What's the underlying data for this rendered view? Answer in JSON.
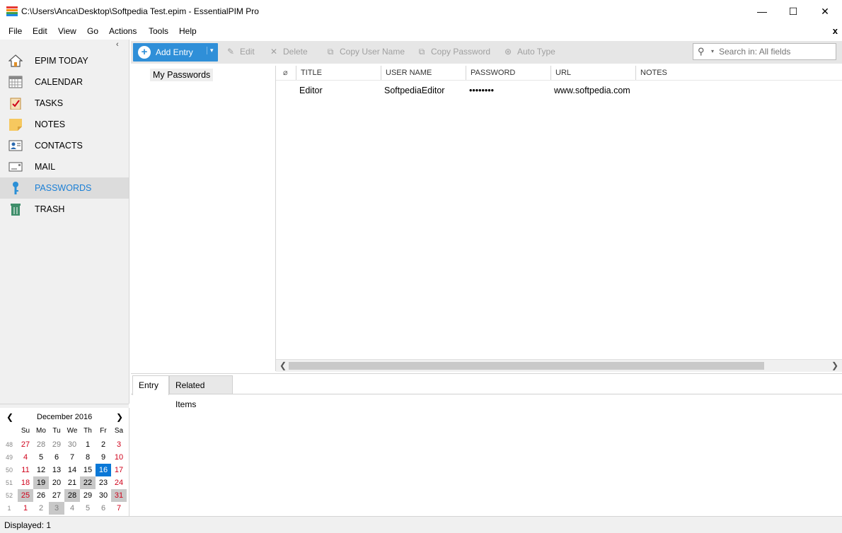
{
  "window": {
    "title": "C:\\Users\\Anca\\Desktop\\Softpedia Test.epim - EssentialPIM Pro",
    "minimize": "—",
    "maximize": "☐",
    "close": "✕"
  },
  "menu": {
    "items": [
      "File",
      "Edit",
      "View",
      "Go",
      "Actions",
      "Tools",
      "Help"
    ],
    "close": "x"
  },
  "sidebar": {
    "collapse": "‹",
    "items": [
      {
        "label": "EPIM TODAY",
        "icon": "home-icon"
      },
      {
        "label": "CALENDAR",
        "icon": "calendar-icon"
      },
      {
        "label": "TASKS",
        "icon": "tasks-icon"
      },
      {
        "label": "NOTES",
        "icon": "notes-icon"
      },
      {
        "label": "CONTACTS",
        "icon": "contacts-icon"
      },
      {
        "label": "MAIL",
        "icon": "mail-icon"
      },
      {
        "label": "PASSWORDS",
        "icon": "key-icon",
        "active": true
      },
      {
        "label": "TRASH",
        "icon": "trash-icon"
      }
    ]
  },
  "calendar": {
    "title": "December  2016",
    "prev": "❮",
    "next": "❯",
    "weekdays": [
      "Su",
      "Mo",
      "Tu",
      "We",
      "Th",
      "Fr",
      "Sa"
    ],
    "weeks": [
      {
        "num": "48",
        "days": [
          "27",
          "28",
          "29",
          "30",
          "1",
          "2",
          "3"
        ]
      },
      {
        "num": "49",
        "days": [
          "4",
          "5",
          "6",
          "7",
          "8",
          "9",
          "10"
        ]
      },
      {
        "num": "50",
        "days": [
          "11",
          "12",
          "13",
          "14",
          "15",
          "16",
          "17"
        ]
      },
      {
        "num": "51",
        "days": [
          "18",
          "19",
          "20",
          "21",
          "22",
          "23",
          "24"
        ]
      },
      {
        "num": "52",
        "days": [
          "25",
          "26",
          "27",
          "28",
          "29",
          "30",
          "31"
        ]
      },
      {
        "num": "1",
        "days": [
          "1",
          "2",
          "3",
          "4",
          "5",
          "6",
          "7"
        ]
      }
    ],
    "today": "16",
    "colors": {
      "weekend": "#d0021b",
      "other_month": "#808080",
      "today_bg": "#0a78d7",
      "highlight_bg": "#c8c8c8"
    }
  },
  "toolbar": {
    "add_entry": "Add Entry",
    "edit": "Edit",
    "delete": "Delete",
    "copy_user": "Copy User Name",
    "copy_password": "Copy Password",
    "auto_type": "Auto Type",
    "search_placeholder": "Search in: All fields"
  },
  "tree": {
    "root": "My Passwords"
  },
  "list": {
    "columns": [
      "TITLE",
      "USER NAME",
      "PASSWORD",
      "URL",
      "NOTES"
    ],
    "rows": [
      {
        "title": "Editor",
        "user": "SoftpediaEditor",
        "password": "••••••••",
        "url": "www.softpedia.com",
        "notes": ""
      }
    ],
    "scroll_left": "❮",
    "scroll_right": "❯"
  },
  "detail": {
    "tabs": [
      "Entry",
      "Related Items"
    ]
  },
  "status": {
    "text": "Displayed: 1"
  },
  "colors": {
    "accent": "#2f8fd8",
    "active_label": "#1a7fd6"
  }
}
